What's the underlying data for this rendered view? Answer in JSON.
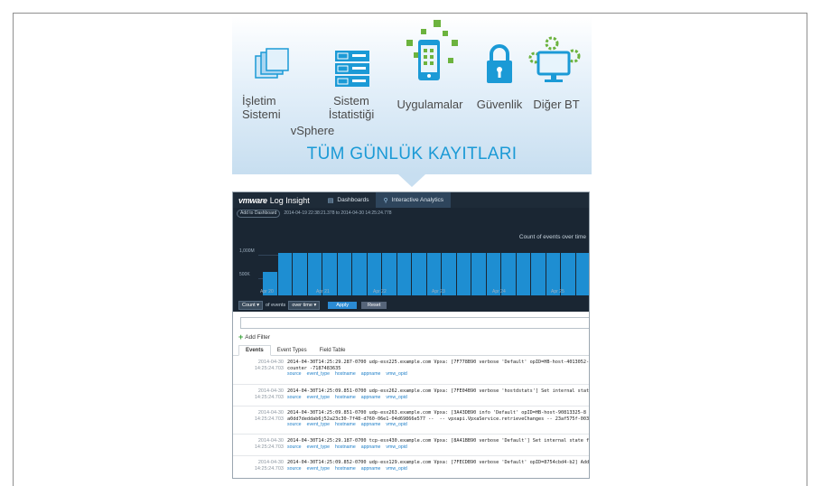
{
  "categories": [
    {
      "name": "os",
      "line1": "İşletim",
      "line2": "Sistemi"
    },
    {
      "name": "vsphere",
      "line1": "vSphere",
      "line2": ""
    },
    {
      "name": "stats",
      "line1": "Sistem",
      "line2": "İstatistiği"
    },
    {
      "name": "apps",
      "line1": "Uygulamalar",
      "line2": ""
    },
    {
      "name": "security",
      "line1": "Güvenlik",
      "line2": ""
    },
    {
      "name": "other",
      "line1": "Diğer BT",
      "line2": ""
    }
  ],
  "banner_title": "TÜM GÜNLÜK KAYITLARI",
  "app": {
    "brand_vm": "vmware",
    "brand_name": "Log Insight",
    "tabs": [
      {
        "label": "Dashboards",
        "icon": "dashboard-icon"
      },
      {
        "label": "Interactive Analytics",
        "icon": "search-icon"
      }
    ],
    "add_to_dashboard": "Add to Dashboard",
    "time_range": "2014-04-19 22:38:21.378 to 2014-04-30 14:25:24.778",
    "chart_title": "Count of events over time",
    "y_ticks": [
      "1,000M",
      "500K"
    ],
    "x_ticks": [
      "Apr 20",
      "Apr 21",
      "Apr 22",
      "Apr 23",
      "Apr 24",
      "Apr 25"
    ],
    "controls": {
      "count_select": "Count",
      "of_events": "of events",
      "over_time_select": "over time",
      "apply": "Apply",
      "reset": "Reset"
    },
    "add_filter": "Add Filter",
    "result_tabs": [
      "Events",
      "Event Types",
      "Field Table"
    ],
    "field_links": [
      "source",
      "event_type",
      "hostname",
      "appname",
      "vmw_opid"
    ],
    "events": [
      {
        "date": "2014-04-30",
        "time": "14:25:24.703",
        "line1": "2014-04-30T14:25:29.287-0700 udp-esx225.example.com Vpxa: [7F778B90 verbose 'Default' opID=HB-host-4013052-",
        "line2": "counter -7187483635"
      },
      {
        "date": "2014-04-30",
        "time": "14:25:24.703",
        "line1": "2014-04-30T14:25:09.851-0700 udp-esx262.example.com Vpxa: [7FE04B90 verbose 'hostdstats'] Set internal stat",
        "line2": ""
      },
      {
        "date": "2014-04-30",
        "time": "14:25:24.703",
        "line1": "2014-04-30T14:25:09.851-0700 udp-esx263.example.com Vpxa: [3A43DB90 info 'Default' opID=HB-host-90813325-8",
        "line2": "a0dd7deddab6j52a23c30-7f48-d760-06e1-04d69866e577 --  -- vpxapi.VpxaService.retrieveChanges -- 23af575f-003"
      },
      {
        "date": "2014-04-30",
        "time": "14:25:24.703",
        "line1": "2014-04-30T14:25:29.187-0700 tcp-esx430.example.com Vpxa: [8A41BB90 verbose 'Default'] Set internal state f",
        "line2": ""
      },
      {
        "date": "2014-04-30",
        "time": "14:25:24.703",
        "line1": "2014-04-30T14:25:09.852-0700 udp-esx129.example.com Vpxa: [7FECDB90 verbose 'Default' opID=8754cbd4-b2] Add",
        "line2": ""
      }
    ]
  },
  "chart_data": {
    "type": "bar",
    "title": "Count of events over time",
    "y_ticks": [
      "1,000M",
      "500K"
    ],
    "x_ticks": [
      "Apr 20",
      "Apr 21",
      "Apr 22",
      "Apr 23",
      "Apr 24",
      "Apr 25"
    ],
    "values": [
      0.55,
      1,
      1,
      1,
      1,
      1,
      1,
      1,
      1,
      1,
      1,
      1,
      1,
      1,
      1,
      1,
      1,
      1,
      1,
      1,
      1,
      1
    ]
  },
  "colors": {
    "accent": "#1b9ad6",
    "bar": "#1e8ed2",
    "app_header": "#1e2b38",
    "chart_bg": "#1a2633",
    "green": "#6cb33e"
  }
}
